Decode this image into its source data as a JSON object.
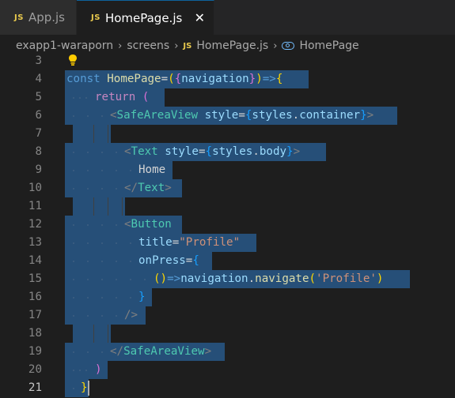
{
  "tabs": [
    {
      "icon_text": "JS",
      "label": "App.js",
      "active": false
    },
    {
      "icon_text": "JS",
      "label": "HomePage.js",
      "active": true
    }
  ],
  "close_glyph": "✕",
  "breadcrumb": {
    "folder": "exapp1-waraporn",
    "subfolder": "screens",
    "file_icon_text": "JS",
    "file": "HomePage.js",
    "symbol": "HomePage",
    "separator": "›"
  },
  "editor": {
    "line_numbers": [
      "3",
      "4",
      "5",
      "6",
      "7",
      "8",
      "9",
      "10",
      "11",
      "12",
      "13",
      "14",
      "15",
      "16",
      "17",
      "18",
      "19",
      "20",
      "21"
    ],
    "current_line": "21",
    "code": {
      "l4": {
        "const": "const",
        "name": "HomePage",
        "eq": "=",
        "p1": "(",
        "b1": "{",
        "param": "navigation",
        "b2": "}",
        "p2": ")",
        "arrow": "=>",
        "b3": "{"
      },
      "l5": {
        "return": "return",
        "p": "("
      },
      "l6": {
        "lt": "<",
        "tag": "SafeAreaView",
        "attr": "style",
        "eq": "=",
        "b1": "{",
        "obj": "styles",
        "dot": ".",
        "prop": "container",
        "b2": "}",
        "gt": ">"
      },
      "l8": {
        "lt": "<",
        "tag": "Text",
        "attr": "style",
        "eq": "=",
        "b1": "{",
        "obj": "styles",
        "dot": ".",
        "prop": "body",
        "b2": "}",
        "gt": ">"
      },
      "l9": {
        "text": "Home"
      },
      "l10": {
        "lt": "</",
        "tag": "Text",
        "gt": ">"
      },
      "l12": {
        "lt": "<",
        "tag": "Button"
      },
      "l13": {
        "attr": "title",
        "eq": "=",
        "str": "\"Profile\""
      },
      "l14": {
        "attr": "onPress",
        "eq": "=",
        "b": "{"
      },
      "l15": {
        "p1": "(",
        "p2": ")",
        "arrow": "=>",
        "obj": "navigation",
        "dot": ".",
        "method": "navigate",
        "p3": "(",
        "str": "'Profile'",
        "p4": ")"
      },
      "l16": {
        "b": "}"
      },
      "l17": {
        "close": "/>"
      },
      "l19": {
        "lt": "</",
        "tag": "SafeAreaView",
        "gt": ">"
      },
      "l20": {
        "p": ")"
      },
      "l21": {
        "b": "}"
      }
    }
  },
  "colors": {
    "background": "#1e1e1e",
    "selection": "#264f78",
    "keyword": "#569cd6",
    "control": "#c586c0",
    "variable": "#9cdcfe",
    "function": "#dcdcaa",
    "tag": "#4ec9b0",
    "string": "#ce9178",
    "js_icon": "#e8c94d"
  },
  "icons": {
    "tab_file": "js-icon",
    "tab_close": "close-icon",
    "breadcrumb_symbol": "symbol-icon",
    "code_action": "lightbulb-icon"
  }
}
